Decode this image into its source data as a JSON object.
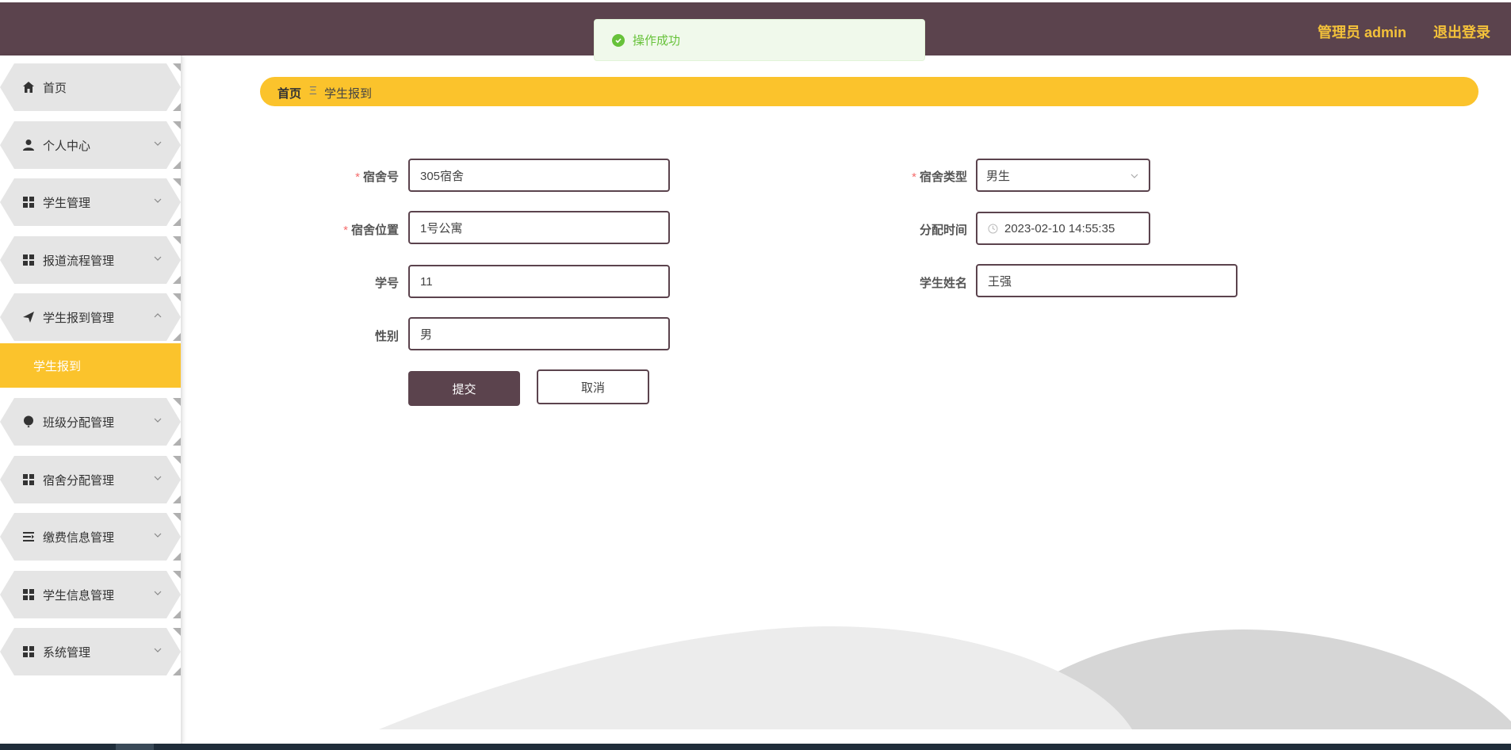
{
  "header": {
    "user_label": "管理员 admin",
    "logout_label": "退出登录"
  },
  "toast": {
    "message": "操作成功",
    "icon": "check-circle-icon"
  },
  "sidebar": {
    "items": [
      {
        "label": "首页",
        "icon": "home-icon"
      },
      {
        "label": "个人中心",
        "icon": "user-icon"
      },
      {
        "label": "学生管理",
        "icon": "grid-icon"
      },
      {
        "label": "报道流程管理",
        "icon": "grid-icon"
      },
      {
        "label": "学生报到管理",
        "icon": "send-icon"
      },
      {
        "label": "班级分配管理",
        "icon": "balloon-icon"
      },
      {
        "label": "宿舍分配管理",
        "icon": "grid-icon"
      },
      {
        "label": "缴费信息管理",
        "icon": "list-icon"
      },
      {
        "label": "学生信息管理",
        "icon": "grid-icon"
      },
      {
        "label": "系统管理",
        "icon": "grid-icon"
      }
    ],
    "active_sub": "学生报到"
  },
  "breadcrumb": {
    "home": "首页",
    "separator": "Ξ",
    "current": "学生报到"
  },
  "form": {
    "dorm_no_label": "宿舍号",
    "dorm_no_value": "305宿舍",
    "dorm_location_label": "宿舍位置",
    "dorm_location_value": "1号公寓",
    "student_no_label": "学号",
    "student_no_value": "11",
    "gender_label": "性别",
    "gender_value": "男",
    "dorm_type_label": "宿舍类型",
    "dorm_type_value": "男生",
    "assign_time_label": "分配时间",
    "assign_time_value": "2023-02-10 14:55:35",
    "student_name_label": "学生姓名",
    "student_name_value": "王强",
    "required_mark": "*",
    "submit_label": "提交",
    "cancel_label": "取消"
  },
  "colors": {
    "header_bg": "#5b434d",
    "accent_yellow": "#fbc32c",
    "success_green": "#67c23a"
  }
}
